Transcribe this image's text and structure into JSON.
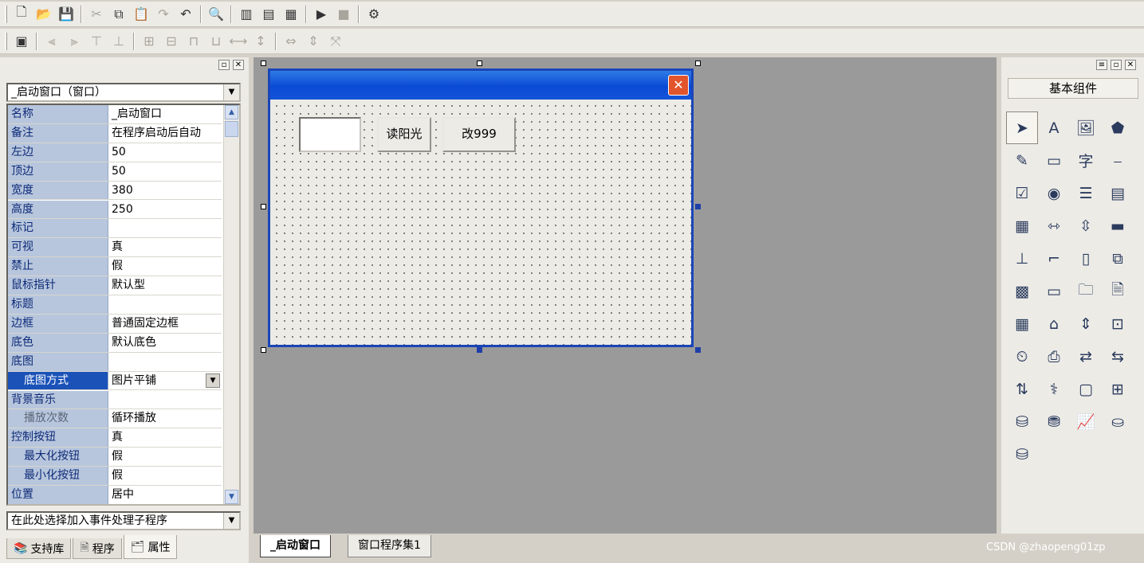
{
  "toolbar1": {
    "icons": [
      "new-file-icon",
      "open-folder-icon",
      "save-icon",
      "cut-icon",
      "copy-icon",
      "paste-icon",
      "redo-icon",
      "undo-icon",
      "find-icon",
      "layout-1-icon",
      "layout-2-icon",
      "layout-3-icon",
      "run-icon",
      "stop-icon",
      "compile-icon"
    ]
  },
  "toolbar2": {
    "icons": [
      "form-icon",
      "align-left-icon",
      "align-right-icon",
      "align-top-icon",
      "align-bottom-icon",
      "center-h-icon",
      "center-v-icon",
      "same-width-icon",
      "same-height-icon",
      "space-h-icon",
      "space-v-icon",
      "size-h-icon",
      "size-v-icon",
      "size-both-icon"
    ]
  },
  "left_panel": {
    "object_combo": "_启动窗口（窗口）",
    "properties": [
      {
        "name": "名称",
        "value": "_启动窗口"
      },
      {
        "name": "备注",
        "value": "在程序启动后自动"
      },
      {
        "name": "左边",
        "value": "50"
      },
      {
        "name": "顶边",
        "value": "50"
      },
      {
        "name": "宽度",
        "value": "380"
      },
      {
        "name": "高度",
        "value": "250"
      },
      {
        "name": "标记",
        "value": ""
      },
      {
        "name": "可视",
        "value": "真"
      },
      {
        "name": "禁止",
        "value": "假"
      },
      {
        "name": "鼠标指针",
        "value": "默认型"
      },
      {
        "name": "标题",
        "value": ""
      },
      {
        "name": "边框",
        "value": "普通固定边框"
      },
      {
        "name": "底色",
        "value": "默认底色"
      },
      {
        "name": "底图",
        "value": ""
      },
      {
        "name": "底图方式",
        "value": "图片平铺"
      },
      {
        "name": "背景音乐",
        "value": ""
      },
      {
        "name": "播放次数",
        "value": "循环播放"
      },
      {
        "name": "控制按钮",
        "value": "真"
      },
      {
        "name": "最大化按钮",
        "value": "假"
      },
      {
        "name": "最小化按钮",
        "value": "假"
      },
      {
        "name": "位置",
        "value": "居中"
      }
    ],
    "event_combo": "在此处选择加入事件处理子程序",
    "tabs": [
      "支持库",
      "程序",
      "属性"
    ]
  },
  "design": {
    "close_glyph": "✕",
    "button_read": "读阳光",
    "button_change": "改999"
  },
  "bottom_tabs": [
    "_启动窗口",
    "窗口程序集1"
  ],
  "right_panel": {
    "header": "基本组件",
    "components": [
      "pointer-icon",
      "label-icon",
      "picture-icon",
      "shape-icon",
      "edit-icon",
      "button-icon",
      "text-char-icon",
      "line-icon",
      "checkbox-icon",
      "radio-icon",
      "listbox-icon",
      "combobox-icon",
      "table-icon",
      "hscroll-icon",
      "vscroll-icon",
      "progress-icon",
      "ruler-icon",
      "bracket-icon",
      "file-icon",
      "image-frame-icon",
      "calendar-icon",
      "input-icon",
      "folder-icon",
      "document-icon",
      "data-grid-icon",
      "network-icon",
      "splitter-icon",
      "counter-icon",
      "timer-icon",
      "printer-icon",
      "transfer-icon",
      "transfer2-icon",
      "transfer3-icon",
      "stethoscope-icon",
      "window-icon",
      "container-icon",
      "db-table-icon",
      "db-icon",
      "chart-icon",
      "odbc-icon",
      "odbc2-icon"
    ]
  },
  "watermark": "CSDN @zhaopeng01zp"
}
